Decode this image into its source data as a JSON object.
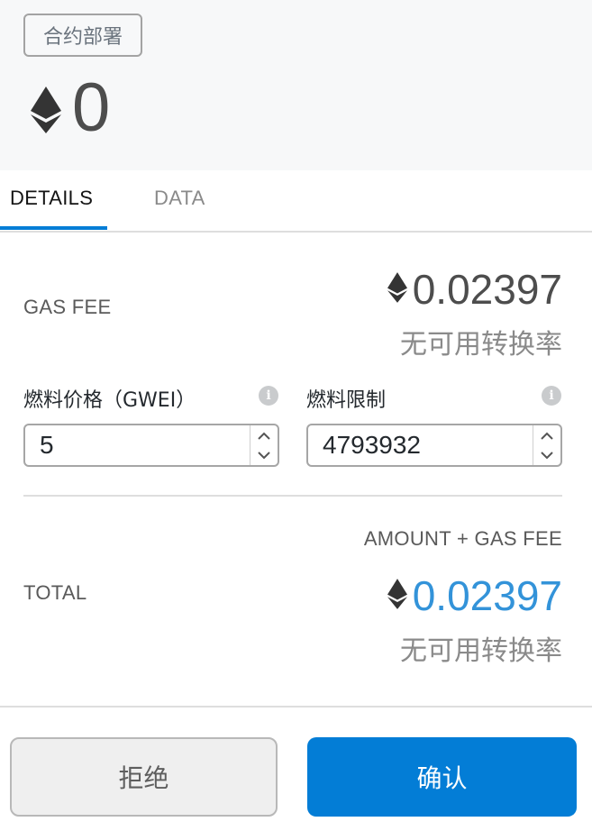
{
  "header": {
    "method_badge": "合约部署",
    "amount": "0"
  },
  "tabs": [
    {
      "label": "DETAILS"
    },
    {
      "label": "DATA"
    }
  ],
  "gas_fee": {
    "label": "GAS FEE",
    "amount": "0.02397",
    "conversion": "无可用转换率"
  },
  "gas_price": {
    "label": "燃料价格（GWEI）",
    "value": "5"
  },
  "gas_limit": {
    "label": "燃料限制",
    "value": "4793932"
  },
  "total": {
    "caption": "AMOUNT + GAS FEE",
    "label": "TOTAL",
    "amount": "0.02397",
    "conversion": "无可用转换率",
    "amount_color": "#3393d9"
  },
  "buttons": {
    "reject": "拒绝",
    "confirm": "确认"
  },
  "colors": {
    "accent": "#037dd6",
    "fee_text": "#4d4d4d"
  },
  "icons": {
    "currency": "ethereum-icon",
    "info": "info-icon",
    "stepper_up": "chevron-up-icon",
    "stepper_down": "chevron-down-icon"
  }
}
